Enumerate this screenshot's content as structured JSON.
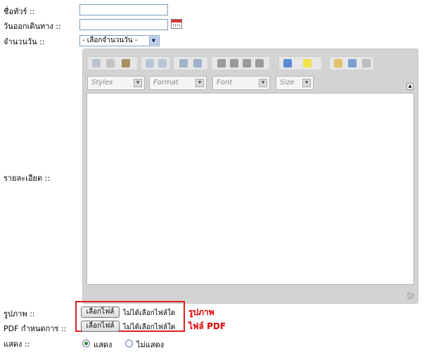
{
  "form": {
    "tour_name_label": "ชื่อทัวร์ ::",
    "departure_label": "วันออกเดินทาง ::",
    "days_label": "จำนวนวัน ::",
    "days_select_value": "- เลือกจำนวนวัน -",
    "detail_label": "รายละเอียด ::",
    "image_label": "รูปภาพ ::",
    "pdf_label": "PDF กำหนดการ ::",
    "show_label": "แสดง ::"
  },
  "editor": {
    "combos": [
      "Styles",
      "Format",
      "Font",
      "Size"
    ]
  },
  "files": {
    "choose_label": "เลือกไฟล์",
    "no_file_text": "ไม่ได้เลือกไฟล์ใด"
  },
  "annotations": {
    "image": "รูปภาพ",
    "pdf": "ไฟล์ PDF",
    "color": "#e00000"
  },
  "visibility": {
    "show_option": "แสดง",
    "hide_option": "ไม่แสดง",
    "selected": "แสดง"
  }
}
